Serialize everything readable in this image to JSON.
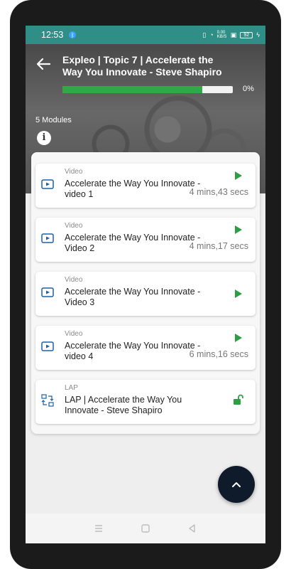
{
  "status_bar": {
    "time": "12:53",
    "net_speed": "0.00 KB/S",
    "battery": "92"
  },
  "header": {
    "title": "Expleo | Topic 7 | Accelerate the Way You Innovate - Steve Shapiro",
    "progress_percent": 0,
    "progress_label": "0%",
    "modules_label": "5 Modules",
    "progress_color": "#32a846"
  },
  "modules": [
    {
      "kind": "Video",
      "title": "Accelerate the Way You Innovate - video 1",
      "duration": "4 mins,43 secs",
      "icon": "video-icon",
      "action": "play-icon"
    },
    {
      "kind": "Video",
      "title": "Accelerate the Way You Innovate - Video 2",
      "duration": "4 mins,17 secs",
      "icon": "video-icon",
      "action": "play-icon"
    },
    {
      "kind": "Video",
      "title": "Accelerate the Way You Innovate - Video 3",
      "duration": "",
      "icon": "video-icon",
      "action": "play-icon"
    },
    {
      "kind": "Video",
      "title": "Accelerate the Way You Innovate - video 4",
      "duration": "6 mins,16 secs",
      "icon": "video-icon",
      "action": "play-icon"
    },
    {
      "kind": "LAP",
      "title": "LAP | Accelerate the Way You Innovate - Steve Shapiro",
      "duration": "",
      "icon": "lap-icon",
      "action": "unlock-icon"
    }
  ],
  "colors": {
    "accent_green": "#2e9e45",
    "icon_blue": "#1f5fa8",
    "fab": "#0f1b2a",
    "status_bar": "#2f8f87"
  }
}
